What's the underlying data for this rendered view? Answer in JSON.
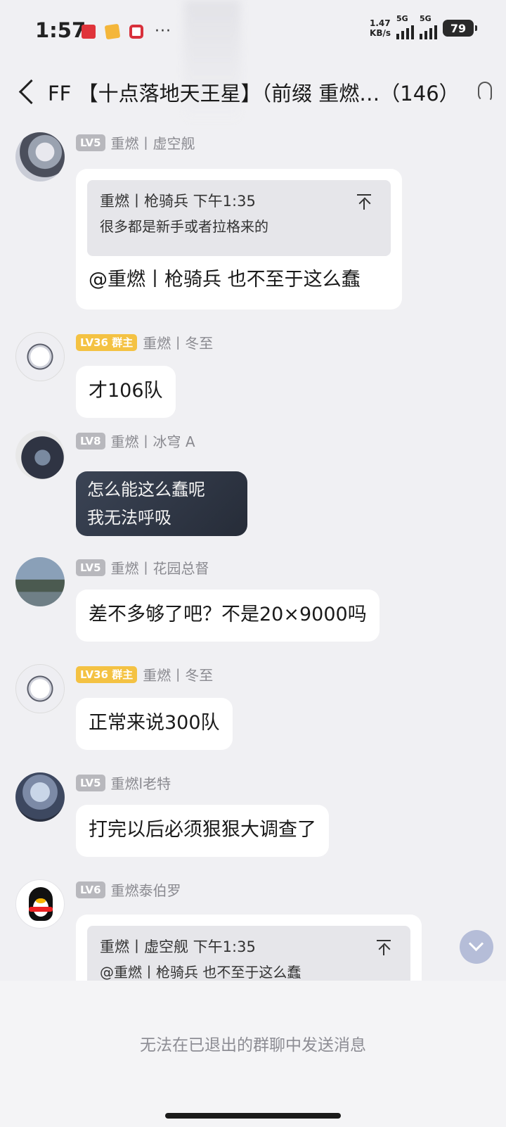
{
  "status_bar": {
    "time": "1:57",
    "more": "···",
    "net_speed_value": "1.47",
    "net_speed_unit": "KB/s",
    "signal1_label": "5G",
    "signal2_label": "5G",
    "battery": "79"
  },
  "header": {
    "title": "FF 【十点落地天王星】（前缀 重燃…（146）"
  },
  "messages": [
    {
      "level": "LV5",
      "nickname": "重燃丨虚空舰",
      "quote": {
        "header": "重燃丨枪骑兵 下午1:35",
        "text": "很多都是新手或者拉格来的"
      },
      "text": "@重燃丨枪骑兵 也不至于这么蠢"
    },
    {
      "level": "LV36 群主",
      "nickname": "重燃丨冬至",
      "text": "才106队"
    },
    {
      "level": "LV8",
      "nickname": "重燃丨冰穹 A",
      "lines": [
        "怎么能这么蠢呢",
        "我无法呼吸"
      ]
    },
    {
      "level": "LV5",
      "nickname": "重燃丨花园总督",
      "text": "差不多够了吧？不是20×9000吗"
    },
    {
      "level": "LV36 群主",
      "nickname": "重燃丨冬至",
      "text": "正常来说300队"
    },
    {
      "level": "LV5",
      "nickname": "重燃l老特",
      "text": "打完以后必须狠狠大调查了"
    },
    {
      "level": "LV6",
      "nickname": "重燃泰伯罗",
      "quote": {
        "header": "重燃丨虚空舰 下午1:35",
        "text": "@重燃丨枪骑兵 也不至于这么蠢"
      }
    }
  ],
  "footer": {
    "notice": "无法在已退出的群聊中发送消息"
  }
}
